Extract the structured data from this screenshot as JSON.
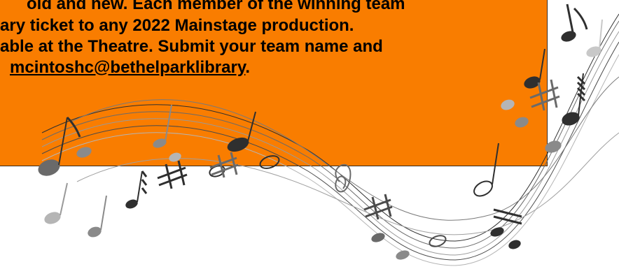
{
  "flyer": {
    "lines": [
      "old and new.  Each member of the winning team",
      "ary ticket to any 2022 Mainstage production.",
      "able at the Theatre.  Submit your team name and"
    ],
    "email": "mcintoshc@bethelparklibrary",
    "email_suffix": "."
  },
  "colors": {
    "box": "#f97d00",
    "notes_dark": "#2f2f2f",
    "notes_gray": "#8a8a8a",
    "notes_light": "#c8c8c8"
  }
}
